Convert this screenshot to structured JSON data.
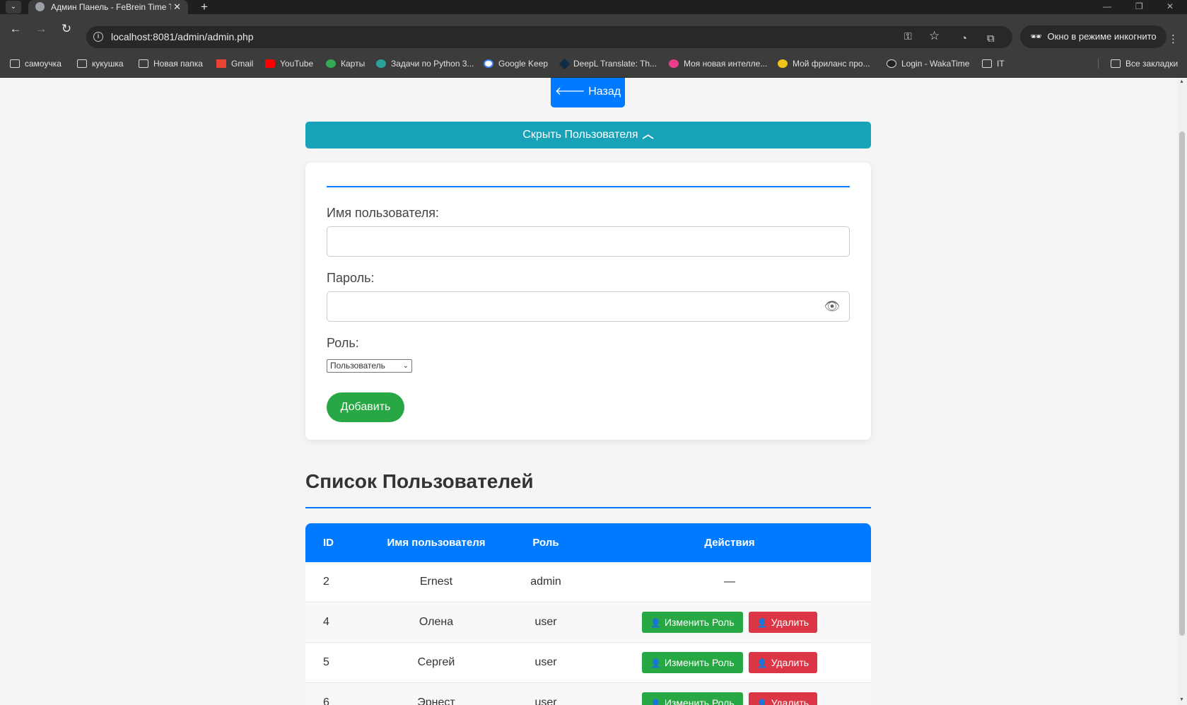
{
  "browser": {
    "tab_title": "Админ Панель - FeBrein Time Tra",
    "tab_close": "✕",
    "new_tab": "+",
    "url": "localhost:8081/admin/admin.php",
    "incognito_label": "Окно в режиме инкогнито",
    "bookmarks": [
      {
        "label": "самоучка",
        "icon": "folder"
      },
      {
        "label": "кукушка",
        "icon": "folder"
      },
      {
        "label": "Новая папка",
        "icon": "folder"
      },
      {
        "label": "Gmail",
        "icon": "gmail"
      },
      {
        "label": "YouTube",
        "icon": "youtube"
      },
      {
        "label": "Карты",
        "icon": "maps"
      },
      {
        "label": "Задачи по Python 3...",
        "icon": "site"
      },
      {
        "label": "Google Keep",
        "icon": "google"
      },
      {
        "label": "DeepL Translate: Th...",
        "icon": "deepl"
      },
      {
        "label": "Моя новая интелле...",
        "icon": "site"
      },
      {
        "label": "Мой фриланс про...",
        "icon": "site"
      },
      {
        "label": "Login - WakaTime",
        "icon": "wakatime"
      },
      {
        "label": "IT",
        "icon": "folder"
      }
    ],
    "all_bookmarks": "Все закладки"
  },
  "page": {
    "back_label": "Назад",
    "toggle_label": "Скрыть Пользователя",
    "form": {
      "username_label": "Имя пользователя:",
      "password_label": "Пароль:",
      "role_label": "Роль:",
      "role_selected": "Пользователь",
      "submit_label": "Добавить"
    },
    "list_title": "Список Пользователей",
    "table": {
      "headers": [
        "ID",
        "Имя пользователя",
        "Роль",
        "Действия"
      ],
      "rows": [
        {
          "id": "2",
          "name": "Ernest",
          "role": "admin",
          "action": "—"
        },
        {
          "id": "4",
          "name": "Олена",
          "role": "user"
        },
        {
          "id": "5",
          "name": "Сергей",
          "role": "user"
        },
        {
          "id": "6",
          "name": "Эрнест",
          "role": "user"
        }
      ],
      "edit_label": "Изменить Роль",
      "delete_label": "Удалить"
    }
  },
  "colors": {
    "primary": "#007bff",
    "info": "#17a2b8",
    "success": "#28a745",
    "danger": "#dc3545"
  }
}
